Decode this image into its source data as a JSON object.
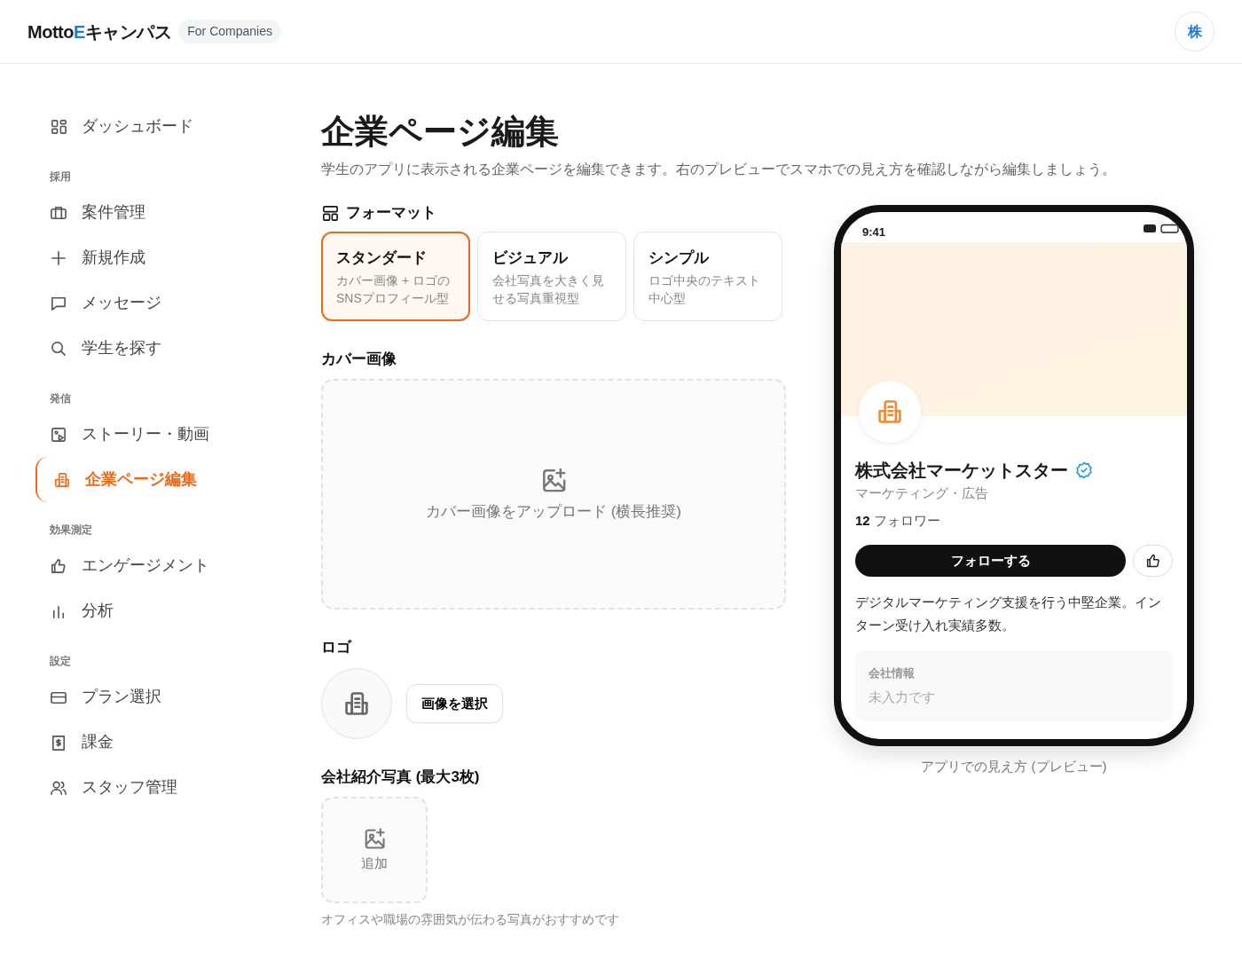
{
  "header": {
    "brand": [
      {
        "text": "Motto",
        "accent": false
      },
      {
        "text": "E",
        "accent": true
      },
      {
        "text": "キャンパス",
        "accent": false
      }
    ],
    "tag": "For Companies",
    "avatar": "株"
  },
  "sidebar": {
    "items": [
      {
        "kind": "link",
        "label": "ダッシュボード",
        "selected": false
      },
      {
        "kind": "section",
        "label": "採用"
      },
      {
        "kind": "link",
        "label": "案件管理",
        "selected": false
      },
      {
        "kind": "link",
        "label": "新規作成",
        "selected": false
      },
      {
        "kind": "link",
        "label": "メッセージ",
        "selected": false
      },
      {
        "kind": "link",
        "label": "学生を探す",
        "selected": false
      },
      {
        "kind": "section",
        "label": "発信"
      },
      {
        "kind": "link",
        "label": "ストーリー・動画",
        "selected": false
      },
      {
        "kind": "link",
        "label": "企業ページ編集",
        "selected": true
      },
      {
        "kind": "section",
        "label": "効果測定"
      },
      {
        "kind": "link",
        "label": "エンゲージメント",
        "selected": false
      },
      {
        "kind": "link",
        "label": "分析",
        "selected": false
      },
      {
        "kind": "section",
        "label": "設定"
      },
      {
        "kind": "link",
        "label": "プラン選択",
        "selected": false
      },
      {
        "kind": "link",
        "label": "課金",
        "selected": false
      },
      {
        "kind": "link",
        "label": "スタッフ管理",
        "selected": false
      }
    ]
  },
  "page": {
    "title": "企業ページ編集",
    "description": "学生のアプリに表示される企業ページを編集できます。右のプレビューでスマホでの見え方を確認しながら編集しましょう。"
  },
  "format": {
    "label": "フォーマット",
    "options": [
      {
        "title": "スタンダード",
        "description": "カバー画像 + ロゴのSNSプロフィール型",
        "selected": true
      },
      {
        "title": "ビジュアル",
        "description": "会社写真を大きく見せる写真重視型",
        "selected": false
      },
      {
        "title": "シンプル",
        "description": "ロゴ中央のテキスト中心型",
        "selected": false
      }
    ]
  },
  "cover": {
    "label": "カバー画像",
    "upload_text": "カバー画像をアップロード (横長推奨)"
  },
  "logo": {
    "label": "ロゴ",
    "button": "画像を選択"
  },
  "photos": {
    "label": "会社紹介写真 (最大3枚)",
    "add_text": "追加",
    "hint": "オフィスや職場の雰囲気が伝わる写真がおすすめです"
  },
  "preview": {
    "time": "9:41",
    "company": "株式会社マーケットスター",
    "verified": true,
    "category": "マーケティング・広告",
    "followers_count": "12",
    "followers_label": "フォロワー",
    "follow_button": "フォローする",
    "bio": "デジタルマーケティング支援を行う中堅企業。インターン受け入れ実績多数。",
    "info_title": "会社情報",
    "info_value": "未入力です",
    "caption": "アプリでの見え方 (プレビュー)"
  }
}
